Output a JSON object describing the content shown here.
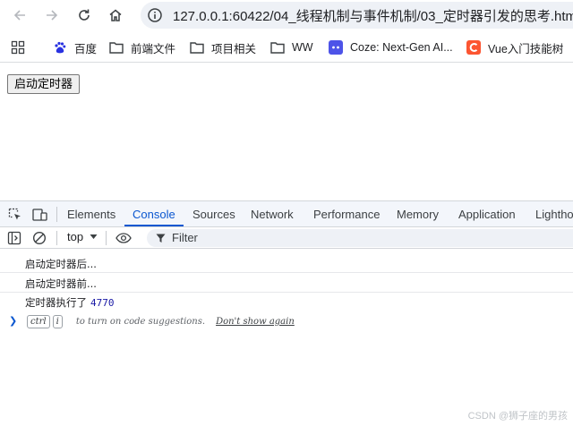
{
  "browser": {
    "url": "127.0.0.1:60422/04_线程机制与事件机制/03_定时器引发的思考.html",
    "bookmarks": [
      {
        "icon": "baidu-icon",
        "label": "百度"
      },
      {
        "icon": "folder-icon",
        "label": "前端文件"
      },
      {
        "icon": "folder-icon",
        "label": "项目相关"
      },
      {
        "icon": "folder-icon",
        "label": "WW"
      },
      {
        "icon": "coze-icon",
        "label": "Coze: Next-Gen AI..."
      },
      {
        "icon": "csdn-icon",
        "label": "Vue入门技能树"
      }
    ]
  },
  "page": {
    "start_button_label": "启动定时器"
  },
  "devtools": {
    "tabs": [
      "Elements",
      "Console",
      "Sources",
      "Network",
      "Performance",
      "Memory",
      "Application",
      "Lighthouse"
    ],
    "active_tab": "Console",
    "context": "top",
    "filter_placeholder": "Filter",
    "logs": [
      {
        "text": "启动定时器后..."
      },
      {
        "text": "启动定时器前..."
      },
      {
        "text": "定时器执行了",
        "value": "4770"
      }
    ],
    "hint": {
      "key1": "ctrl",
      "key2": "i",
      "text": "to turn on code suggestions.",
      "link": "Don't show again"
    }
  },
  "watermark": "CSDN @狮子座的男孩",
  "colors": {
    "accent": "#0b57d0",
    "number": "#1a1aa6"
  }
}
